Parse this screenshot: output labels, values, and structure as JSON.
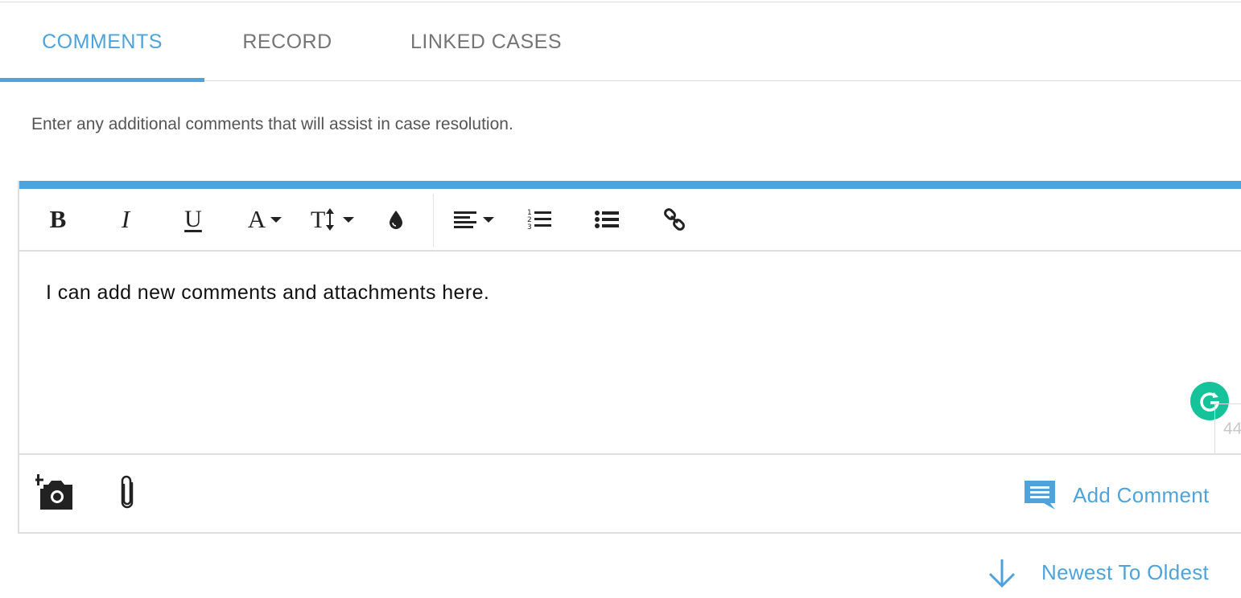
{
  "tabs": [
    {
      "label": "COMMENTS",
      "active": true
    },
    {
      "label": "RECORD",
      "active": false
    },
    {
      "label": "LINKED CASES",
      "active": false
    }
  ],
  "hint_text": "Enter any additional comments that will assist in case resolution.",
  "toolbar": {
    "bold": {
      "label": "B",
      "icon": "bold-icon"
    },
    "italic": {
      "label": "I",
      "icon": "italic-icon"
    },
    "underline": {
      "label": "U",
      "icon": "underline-icon"
    },
    "font": {
      "label": "A",
      "icon": "font-family-icon"
    },
    "font_size": {
      "icon": "font-size-icon"
    },
    "color": {
      "icon": "color-drop-icon"
    },
    "align": {
      "icon": "align-left-icon"
    },
    "ordered_list": {
      "icon": "ordered-list-icon"
    },
    "unordered_list": {
      "icon": "unordered-list-icon"
    },
    "link": {
      "icon": "link-icon"
    }
  },
  "editor": {
    "content": "I can add new comments and attachments here.",
    "char_counter": "44"
  },
  "bottom_bar": {
    "add_photo_icon": "add-photo-icon",
    "attach_icon": "paperclip-icon",
    "add_comment_label": "Add Comment"
  },
  "sort": {
    "label": "Newest To Oldest",
    "icon": "arrow-down-icon"
  },
  "colors": {
    "accent": "#4fa3db",
    "grammarly": "#15c39a",
    "tab_inactive": "#757575",
    "border": "#dedede"
  }
}
